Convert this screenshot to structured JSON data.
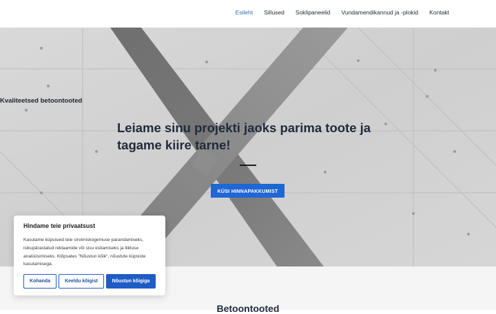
{
  "nav": {
    "items": [
      {
        "label": "Esileht",
        "active": true
      },
      {
        "label": "Sillused",
        "active": false
      },
      {
        "label": "Soklipaneelid",
        "active": false
      },
      {
        "label": "Vundamendikannud ja -plokid",
        "active": false
      },
      {
        "label": "Kontakt",
        "active": false
      }
    ]
  },
  "hero": {
    "eyebrow": "Kvaliteetsed betoontooted",
    "headline": "Leiame sinu projekti jaoks parima toote ja tagame kiire tarne!",
    "cta_label": "KÜSI HINNAPAKKUMIST"
  },
  "lower": {
    "section_title": "Betoontooted"
  },
  "cookie": {
    "title": "Hindame teie privaatsust",
    "body": "Kasutame küpsiseid teie sirvimiskogemuse parandamiseks, isikupärastatud reklaamide või sisu esitamiseks ja liikluse analüüsimiseks. Klõpsates \"Nõustun kõik\", nõustute küpsiste kasutamisega.",
    "customize_label": "Kohanda",
    "reject_label": "Keeldu kõigist",
    "accept_label": "Nõustun kõigiga"
  },
  "colors": {
    "accent": "#1f66d6",
    "nav_active": "#2f6fb7",
    "text_dark": "#1f2b3a"
  }
}
